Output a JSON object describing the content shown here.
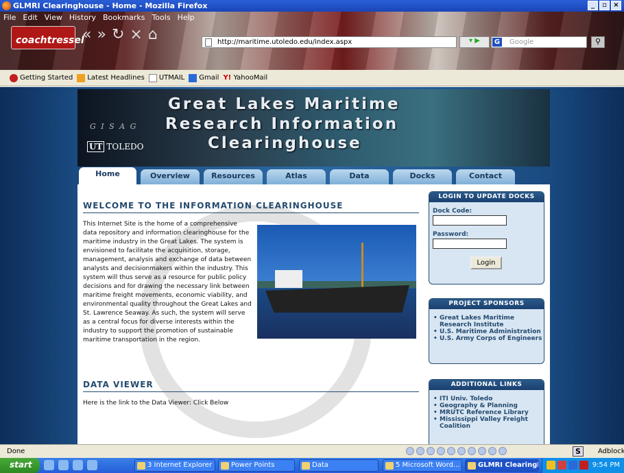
{
  "window": {
    "title": "GLMRI Clearinghouse - Home - Mozilla Firefox"
  },
  "menu": [
    "File",
    "Edit",
    "View",
    "History",
    "Bookmarks",
    "Tools",
    "Help"
  ],
  "theme": {
    "logo": "coachtressel"
  },
  "url": "http://maritime.utoledo.edu/index.aspx",
  "search": {
    "placeholder": "Google"
  },
  "bookmarks": [
    "Getting Started",
    "Latest Headlines",
    "UTMAIL",
    "Gmail",
    "YahooMail"
  ],
  "banner": {
    "line1": "Great Lakes Maritime",
    "line2": "Research Information",
    "line3": "Clearinghouse",
    "gisag": "G I S A G",
    "ut": "TOLEDO"
  },
  "tabs": [
    "Home",
    "Overview",
    "Resources",
    "Atlas",
    "Data",
    "Docks",
    "Contact"
  ],
  "welcome": {
    "heading": "WELCOME TO THE INFORMATION CLEARINGHOUSE",
    "text": "This Internet Site is the home of a comprehensive data repository and information clearinghouse for the maritime industry in the Great Lakes. The system is envisioned to facilitate the acquisition, storage, management, analysis and exchange of data between analysts and decisionmakers within the industry. This system will thus serve as a resource for public policy decisions and for drawing the necessary link between maritime freight movements, economic viability, and environmental quality throughout the Great Lakes and St. Lawrence Seaway. As such, the system will serve as a central focus for diverse interests within the industry to support the promotion of sustainable maritime transportation in the region."
  },
  "data_viewer": {
    "heading": "DATA VIEWER",
    "text": "Here is the link to the Data Viewer: Click Below"
  },
  "login": {
    "heading": "LOGIN TO UPDATE DOCKS",
    "dock_code_label": "Dock Code:",
    "password_label": "Password:",
    "button": "Login"
  },
  "sponsors": {
    "heading": "PROJECT SPONSORS",
    "items": [
      "Great Lakes Maritime Research Institute",
      "U.S. Maritime Administration",
      "U.S. Army Corps of Engineers"
    ]
  },
  "links": {
    "heading": "ADDITIONAL LINKS",
    "items": [
      "ITI Univ. Toledo",
      "Geography & Planning",
      "MRUTC Reference Library",
      "Mississippi Valley Freight Coalition"
    ]
  },
  "status": {
    "text": "Done",
    "adblock": "Adblock"
  },
  "taskbar": {
    "start": "start",
    "tasks": [
      "3 Internet Explorer",
      "Power Points",
      "Data",
      "5 Microsoft Word...",
      "GLMRI Clearingh..."
    ],
    "clock": "9:54 PM"
  }
}
